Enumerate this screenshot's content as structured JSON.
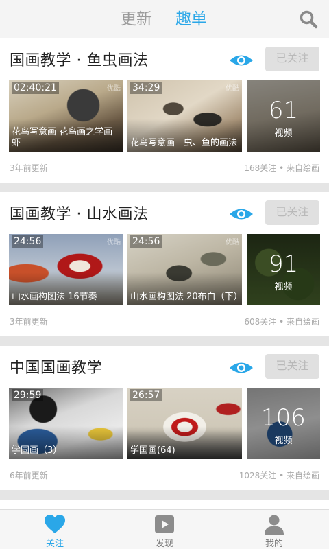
{
  "header": {
    "tabs": [
      "更新",
      "趣单"
    ],
    "active_tab": "趣单"
  },
  "cards": [
    {
      "title": "国画教学 · 鱼虫画法",
      "follow_label": "已关注",
      "videos": [
        {
          "duration": "02:40:21",
          "title": "花鸟写意画 花鸟画之学画虾",
          "brand": "优酷"
        },
        {
          "duration": "34:29",
          "title": "花鸟写意画　虫、鱼的画法",
          "brand": "优酷"
        }
      ],
      "count": "61",
      "count_label": "视频",
      "updated": "3年前更新",
      "stats": "168关注 • 来自绘画"
    },
    {
      "title": "国画教学 · 山水画法",
      "follow_label": "已关注",
      "videos": [
        {
          "duration": "24:56",
          "title": "山水画构图法 16节奏",
          "brand": "优酷"
        },
        {
          "duration": "24:56",
          "title": "山水画构图法 20布白（下）",
          "brand": "优酷"
        }
      ],
      "count": "91",
      "count_label": "视频",
      "updated": "3年前更新",
      "stats": "608关注 • 来自绘画"
    },
    {
      "title": "中国国画教学",
      "follow_label": "已关注",
      "videos": [
        {
          "duration": "29:59",
          "title": "学国画（3）",
          "brand": ""
        },
        {
          "duration": "26:57",
          "title": "学国画(64)",
          "brand": ""
        }
      ],
      "count": "106",
      "count_label": "视频",
      "updated": "6年前更新",
      "stats": "1028关注 • 来自绘画"
    }
  ],
  "nav": [
    {
      "label": "关注",
      "icon": "heart-icon",
      "active": true
    },
    {
      "label": "发现",
      "icon": "play-icon",
      "active": false
    },
    {
      "label": "我的",
      "icon": "user-icon",
      "active": false
    }
  ],
  "colors": {
    "accent": "#2aa7e8",
    "follow_bg": "#e0e0e0",
    "meta_text": "#aaaaaa"
  }
}
